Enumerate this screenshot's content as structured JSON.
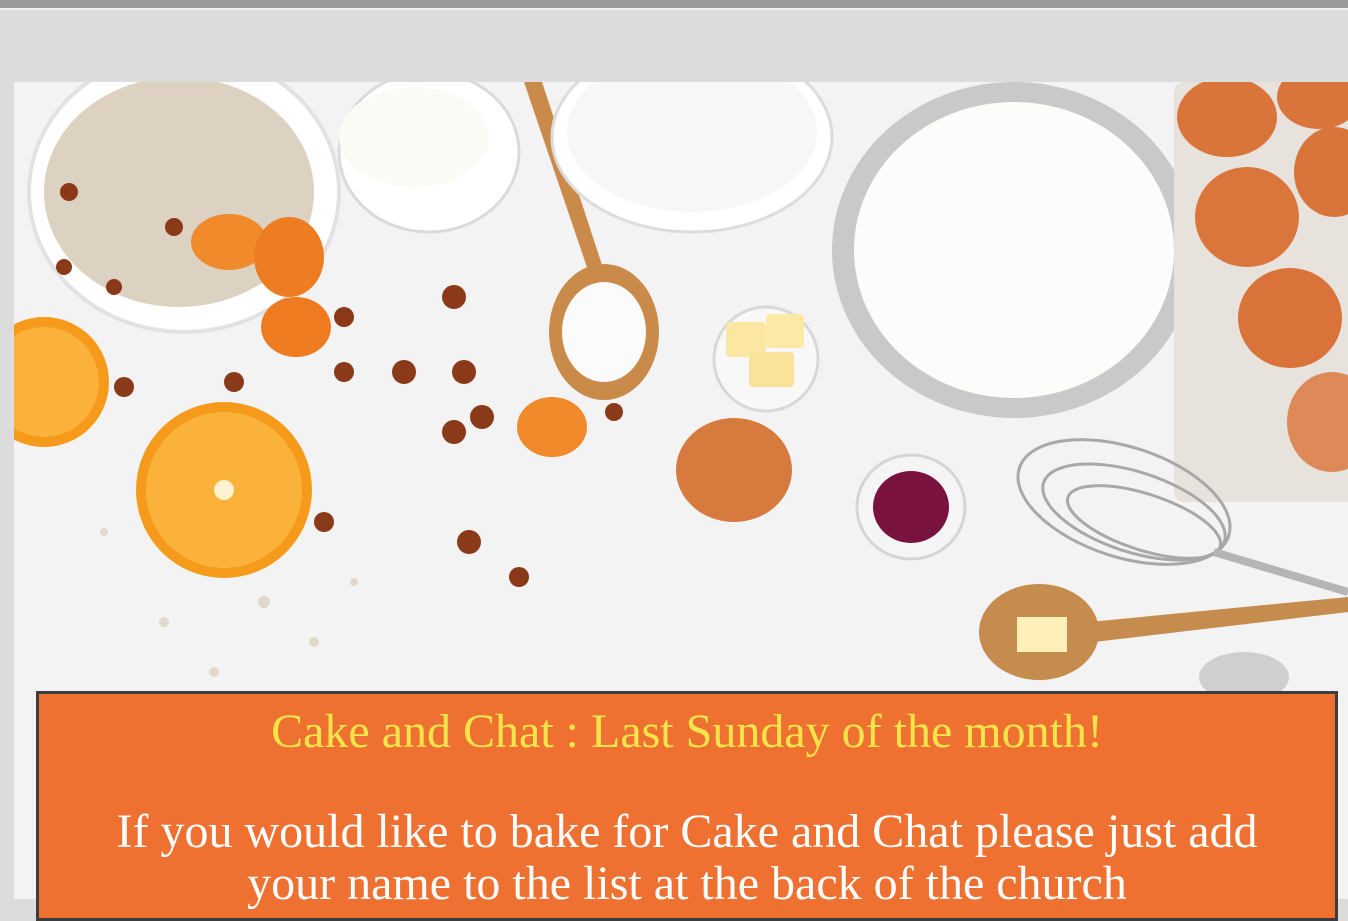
{
  "photo": {
    "subject": "baking-ingredients-photo"
  },
  "banner": {
    "title": "Cake and Chat : Last Sunday of the month!",
    "body": "If you would like to bake for Cake and Chat please just add your name to the list at the back of the church"
  },
  "colors": {
    "banner_bg": "#ef7132",
    "title_text": "#f5e44a",
    "body_text": "#ffffff",
    "page_bg": "#dcdcdc"
  }
}
